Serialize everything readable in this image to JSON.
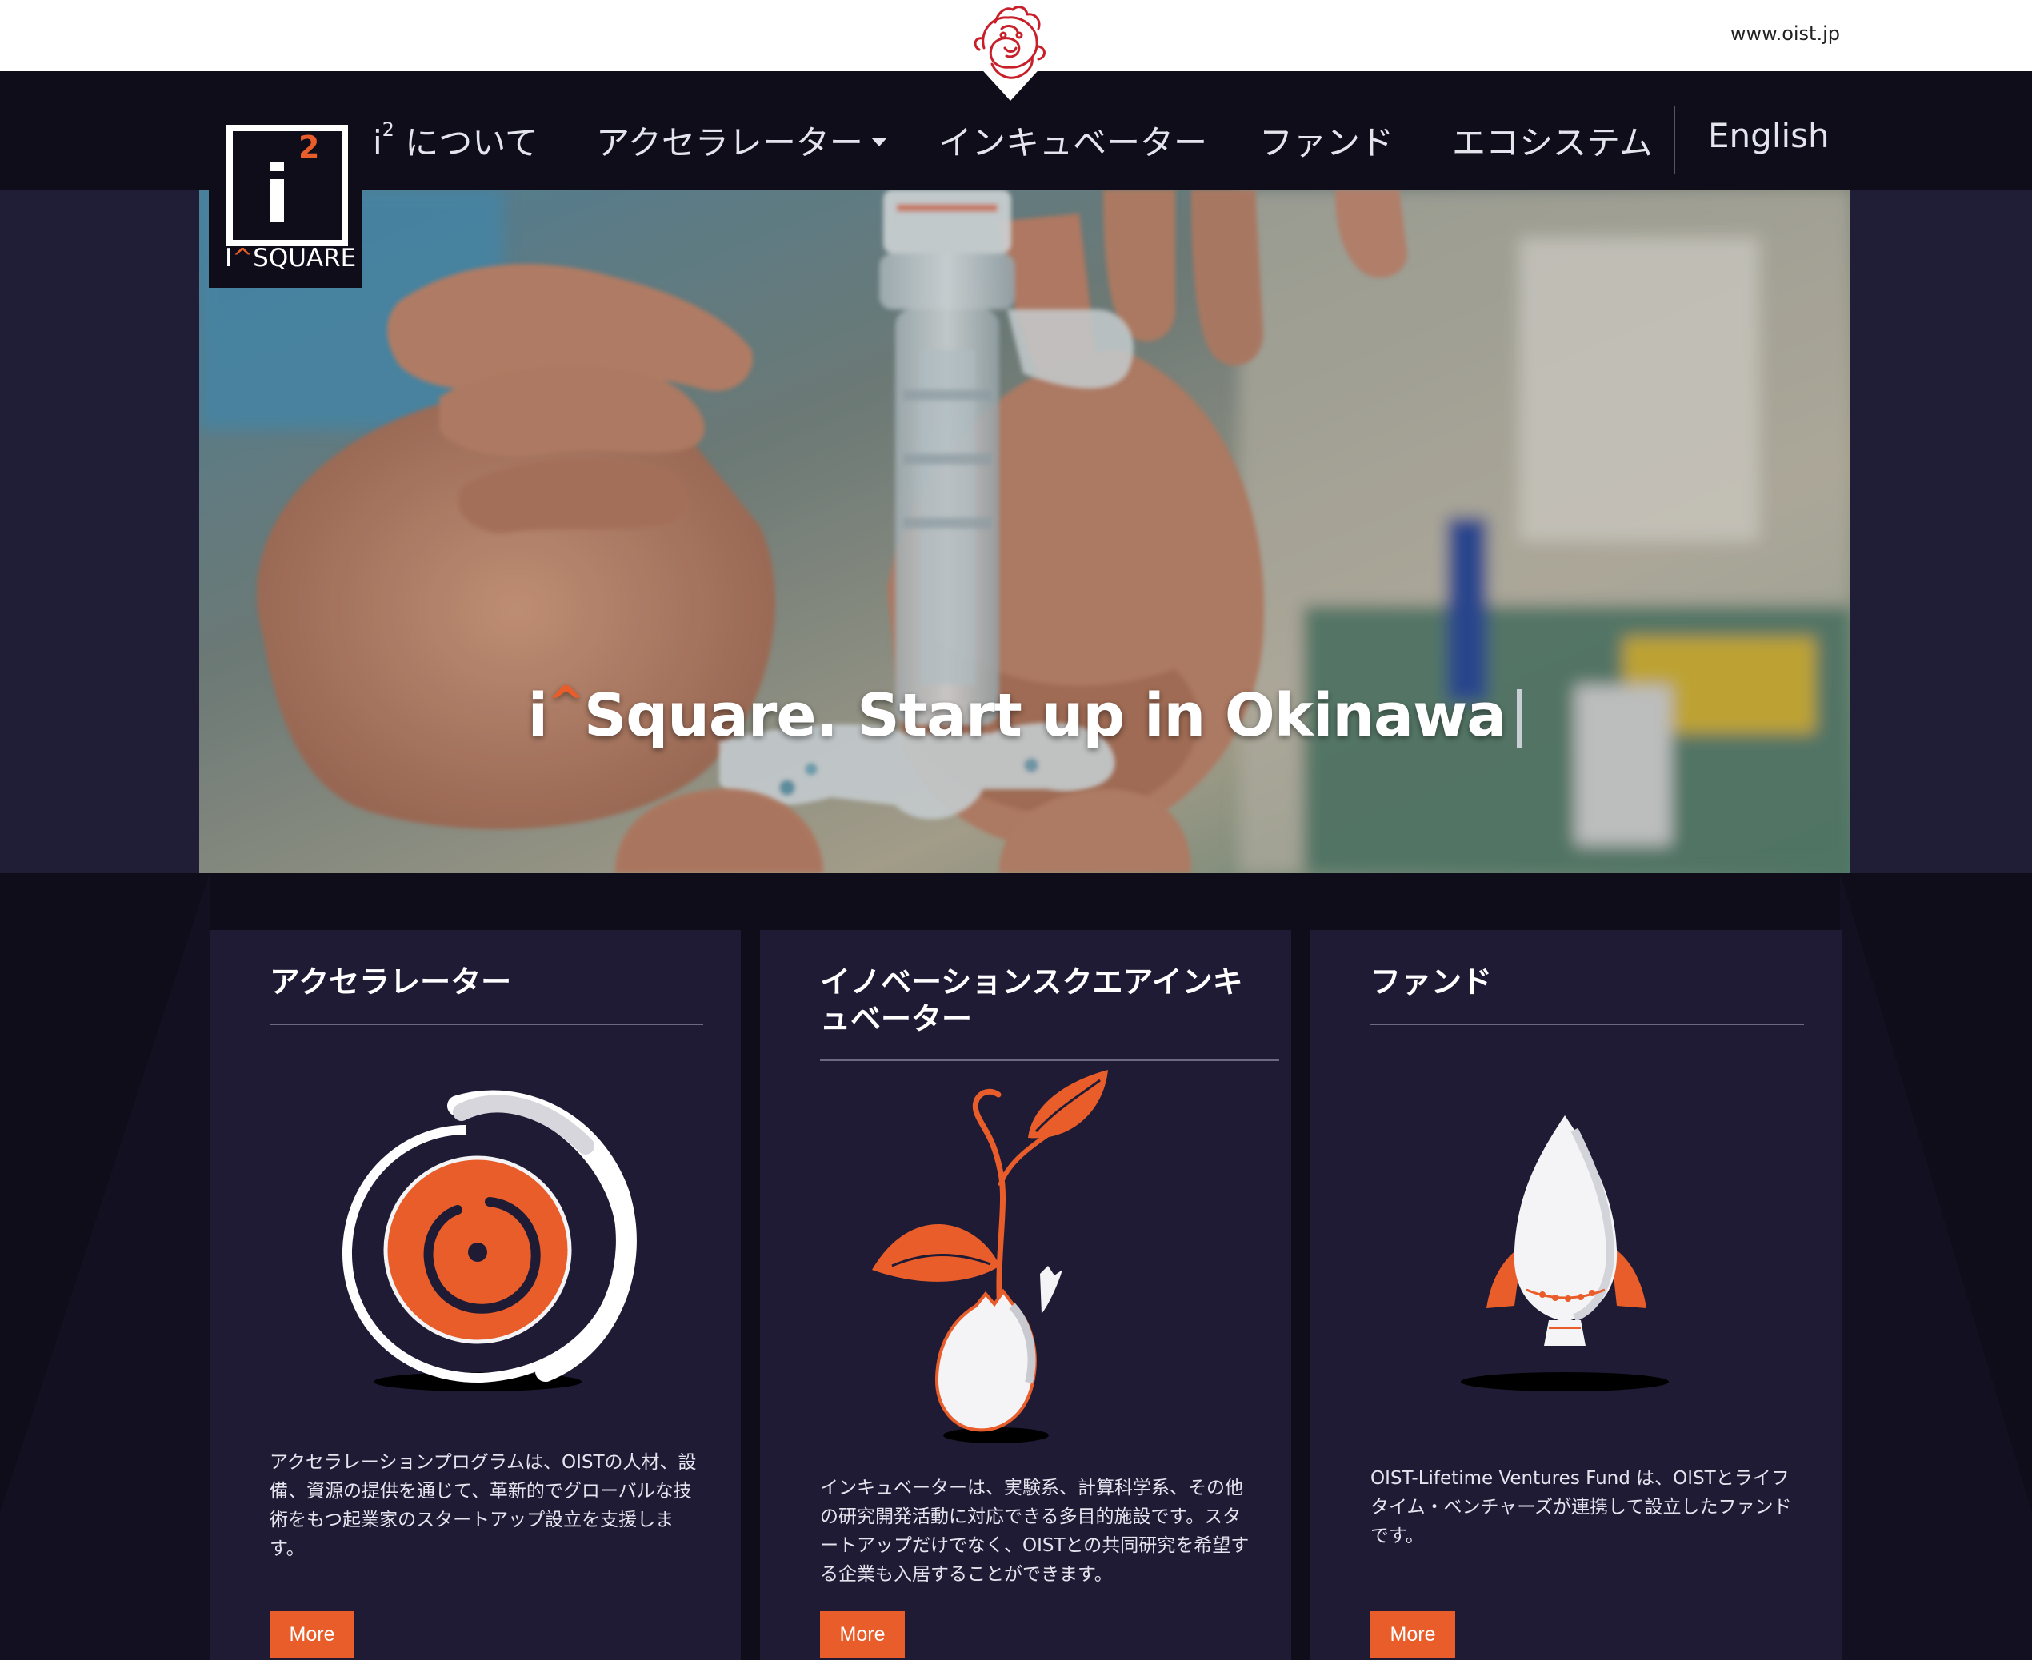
{
  "topbar": {
    "oist_link": "www.oist.jp",
    "emblem_icon": "oist-dragon-emblem-icon"
  },
  "nav": {
    "about_prefix": "i",
    "about_sup": "2",
    "about_label": " について",
    "accelerator": "アクセラレーター",
    "incubator": "インキュベーター",
    "fund": "ファンド",
    "ecosystem": "エコシステム",
    "language": "English"
  },
  "logo": {
    "two": "2",
    "text_i": "I",
    "text_caret": "^",
    "text_rest": "SQUARE"
  },
  "hero": {
    "title_i": "i",
    "title_caret": "^",
    "title_rest": "Square. Start up in Okinawa"
  },
  "cards": [
    {
      "title": "アクセラレーター",
      "icon": "orange-disc-with-spiral-icon",
      "text": "アクセラレーションプログラムは、OISTの人材、設備、資源の提供を通じて、革新的でグローバルな技術をもつ起業家のスタートアップ設立を支援します。",
      "button": "More"
    },
    {
      "title": "イノベーションスクエアインキュベーター",
      "icon": "sprout-from-eggshell-icon",
      "text": "インキュベーターは、実験系、計算科学系、その他の研究開発活動に対応できる多目的施設です。スタートアップだけでなく、OISTとの共同研究を希望する企業も入居することができます。",
      "button": "More"
    },
    {
      "title": "ファンド",
      "icon": "rocket-icon",
      "text": "OIST-Lifetime Ventures Fund は、OISTとライフタイム・ベンチャーズが連携して設立したファンドです。",
      "button": "More"
    }
  ],
  "colors": {
    "accent": "#e85d2a",
    "nav_bg": "#0f0d1a",
    "card_bg": "#1f1b35",
    "hero_side_bg": "#201d36"
  }
}
